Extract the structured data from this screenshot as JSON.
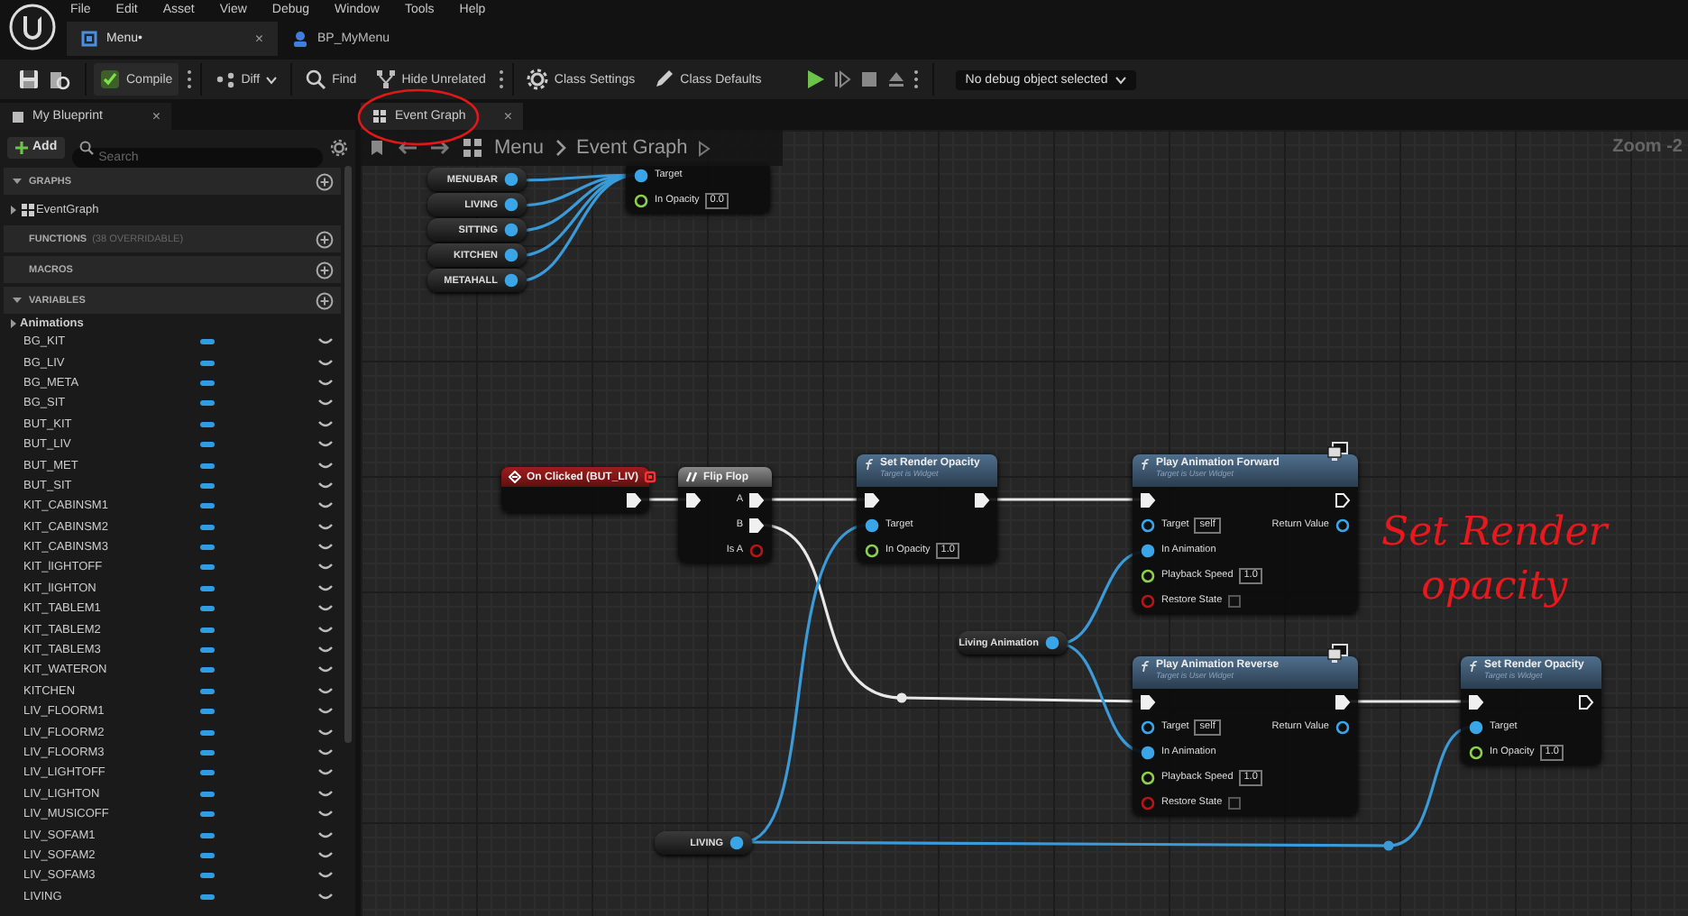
{
  "menu_bar": [
    "File",
    "Edit",
    "Asset",
    "View",
    "Debug",
    "Window",
    "Tools",
    "Help"
  ],
  "document_tabs": [
    {
      "label": "Menu•",
      "selected": true,
      "close": "×"
    },
    {
      "label": "BP_MyMenu",
      "selected": false
    }
  ],
  "toolbar": {
    "buttons": [
      {
        "kind": "compile",
        "label": "Compile"
      },
      {
        "kind": "diff",
        "label": "Diff"
      },
      {
        "kind": "find",
        "label": "Find"
      },
      {
        "kind": "hide",
        "label": "Hide Unrelated"
      },
      {
        "kind": "settings",
        "label": "Class Settings"
      },
      {
        "kind": "defaults",
        "label": "Class Defaults"
      }
    ],
    "debug_filter": "No debug object selected"
  },
  "my_blueprint": {
    "tab": "My Blueprint",
    "close": "×",
    "add": "Add",
    "search_placeholder": "Search",
    "sections": [
      {
        "title": "GRAPHS",
        "expanded": true,
        "items": [
          {
            "kind": "graph",
            "label": "EventGraph",
            "expanded": false
          }
        ]
      },
      {
        "title": "FUNCTIONS",
        "note": "(38 OVERRIDABLE)",
        "expanded": false
      },
      {
        "title": "MACROS",
        "expanded": false
      },
      {
        "title": "VARIABLES",
        "expanded": true,
        "items": [
          {
            "kind": "category",
            "label": "Animations",
            "expanded": false
          },
          {
            "kind": "variable",
            "label": "BG_KIT"
          },
          {
            "kind": "variable",
            "label": "BG_LIV"
          },
          {
            "kind": "variable",
            "label": "BG_META"
          },
          {
            "kind": "variable",
            "label": "BG_SIT"
          },
          {
            "kind": "variable",
            "label": "BUT_KIT"
          },
          {
            "kind": "variable",
            "label": "BUT_LIV"
          },
          {
            "kind": "variable",
            "label": "BUT_MET"
          },
          {
            "kind": "variable",
            "label": "BUT_SIT"
          },
          {
            "kind": "variable",
            "label": "KIT_CABINSM1"
          },
          {
            "kind": "variable",
            "label": "KIT_CABINSM2"
          },
          {
            "kind": "variable",
            "label": "KIT_CABINSM3"
          },
          {
            "kind": "variable",
            "label": "KIT_lIGHTOFF"
          },
          {
            "kind": "variable",
            "label": "KIT_lIGHTON"
          },
          {
            "kind": "variable",
            "label": "KIT_TABLEM1"
          },
          {
            "kind": "variable",
            "label": "KIT_TABLEM2"
          },
          {
            "kind": "variable",
            "label": "KIT_TABLEM3"
          },
          {
            "kind": "variable",
            "label": "KIT_WATERON"
          },
          {
            "kind": "variable",
            "label": "KITCHEN"
          },
          {
            "kind": "variable",
            "label": "LIV_FLOORM1"
          },
          {
            "kind": "variable",
            "label": "LIV_FLOORM2"
          },
          {
            "kind": "variable",
            "label": "LIV_FLOORM3"
          },
          {
            "kind": "variable",
            "label": "LIV_LIGHTOFF"
          },
          {
            "kind": "variable",
            "label": "LIV_LIGHTON"
          },
          {
            "kind": "variable",
            "label": "LIV_MUSICOFF"
          },
          {
            "kind": "variable",
            "label": "LIV_SOFAM1"
          },
          {
            "kind": "variable",
            "label": "LIV_SOFAM2"
          },
          {
            "kind": "variable",
            "label": "LIV_SOFAM3"
          },
          {
            "kind": "variable",
            "label": "LIVING"
          }
        ]
      }
    ]
  },
  "graph": {
    "tab": "Event Graph",
    "close": "×",
    "breadcrumb": [
      "Menu",
      "Event Graph"
    ],
    "zoom": "Zoom -2",
    "nodes": [
      {
        "kind": "variable_get",
        "label": "MENUBAR"
      },
      {
        "kind": "variable_get",
        "label": "LIVING"
      },
      {
        "kind": "variable_get",
        "label": "SITTING"
      },
      {
        "kind": "variable_get",
        "label": "KITCHEN"
      },
      {
        "kind": "variable_get",
        "label": "METAHALL"
      },
      {
        "kind": "function",
        "inputs": [
          {
            "kind": "object",
            "label": "Target",
            "connected": true
          },
          {
            "kind": "float",
            "label": "In Opacity",
            "value": "0.0",
            "connected": false
          }
        ]
      },
      {
        "kind": "event",
        "title": "On Clicked (BUT_LIV)",
        "outputs": [
          {
            "kind": "exec",
            "connected": true
          }
        ]
      },
      {
        "kind": "flow",
        "title": "Flip Flop",
        "inputs": [
          {
            "kind": "exec",
            "connected": true
          }
        ],
        "outputs": [
          {
            "kind": "exec",
            "label": "A",
            "connected": true
          },
          {
            "kind": "exec",
            "label": "B",
            "connected": true
          },
          {
            "kind": "bool",
            "label": "Is A",
            "connected": false
          }
        ]
      },
      {
        "kind": "function",
        "title": "Set Render Opacity",
        "subtitle": "Target is Widget",
        "inputs": [
          {
            "kind": "exec",
            "connected": true
          },
          {
            "kind": "object",
            "label": "Target",
            "connected": true
          },
          {
            "kind": "float",
            "label": "In Opacity",
            "value": "1.0",
            "connected": false
          }
        ],
        "outputs": [
          {
            "kind": "exec",
            "connected": true
          }
        ]
      },
      {
        "kind": "function",
        "title": "Play Animation Forward",
        "subtitle": "Target is User Widget",
        "network_icon": true,
        "inputs": [
          {
            "kind": "exec",
            "connected": true
          },
          {
            "kind": "object",
            "label": "Target",
            "value": "self",
            "connected": false
          },
          {
            "kind": "object",
            "label": "In Animation",
            "connected": true
          },
          {
            "kind": "float",
            "label": "Playback Speed",
            "value": "1.0",
            "connected": false
          },
          {
            "kind": "bool",
            "label": "Restore State",
            "checked": false,
            "connected": false
          }
        ],
        "outputs": [
          {
            "kind": "exec",
            "connected": false
          },
          {
            "kind": "object",
            "label": "Return Value",
            "connected": false
          }
        ]
      },
      {
        "kind": "variable_get",
        "label": "Living Animation"
      },
      {
        "kind": "function",
        "title": "Play Animation Reverse",
        "subtitle": "Target is User Widget",
        "network_icon": true,
        "inputs": [
          {
            "kind": "exec",
            "connected": true
          },
          {
            "kind": "object",
            "label": "Target",
            "value": "self",
            "connected": false
          },
          {
            "kind": "object",
            "label": "In Animation",
            "connected": true
          },
          {
            "kind": "float",
            "label": "Playback Speed",
            "value": "1.0",
            "connected": false
          },
          {
            "kind": "bool",
            "label": "Restore State",
            "checked": false,
            "connected": false
          }
        ],
        "outputs": [
          {
            "kind": "exec",
            "connected": true
          },
          {
            "kind": "object",
            "label": "Return Value",
            "connected": false
          }
        ]
      },
      {
        "kind": "function",
        "title": "Set Render Opacity",
        "subtitle": "Target is Widget",
        "inputs": [
          {
            "kind": "exec",
            "connected": true
          },
          {
            "kind": "object",
            "label": "Target",
            "connected": true
          },
          {
            "kind": "float",
            "label": "In Opacity",
            "value": "1.0",
            "connected": false
          }
        ],
        "outputs": [
          {
            "kind": "exec",
            "connected": false
          }
        ]
      },
      {
        "kind": "variable_get",
        "label": "LIVING"
      }
    ],
    "annotations": [
      {
        "kind": "circle"
      },
      {
        "kind": "handwriting",
        "text": "Set Render\nopacity"
      }
    ]
  }
}
